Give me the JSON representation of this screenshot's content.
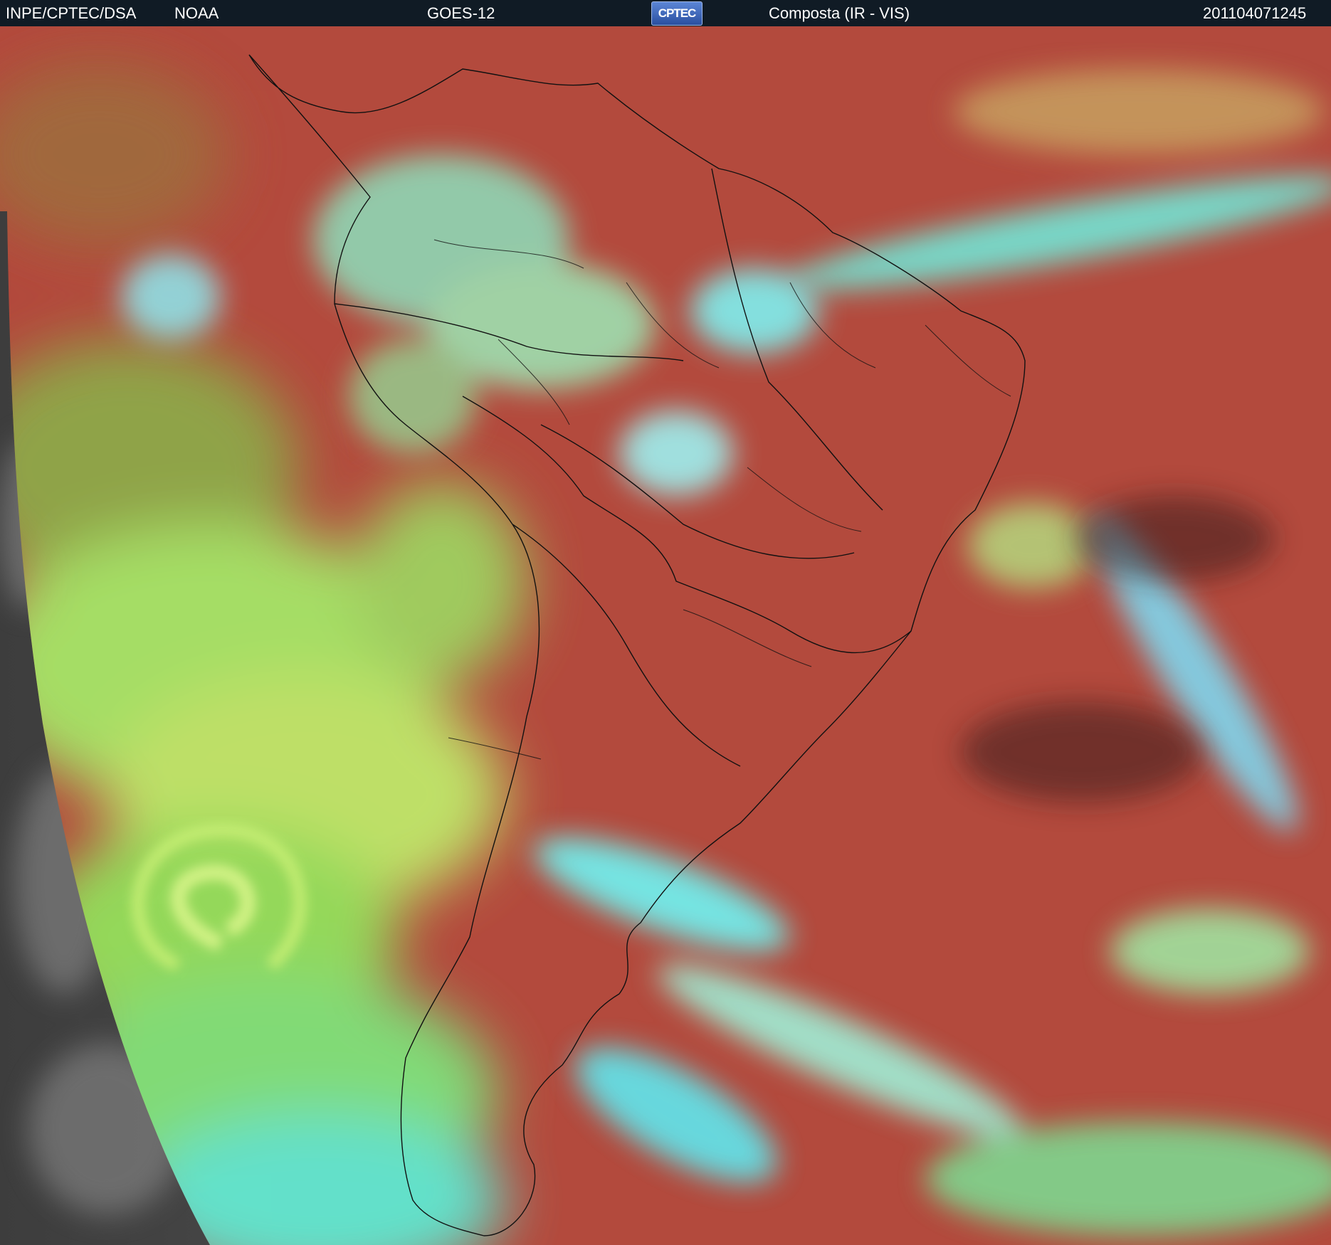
{
  "header": {
    "source": "INPE/CPTEC/DSA",
    "agency": "NOAA",
    "satellite": "GOES-12",
    "logo_text": "CPTEC",
    "product": "Composta (IR - VIS)",
    "timestamp": "201104071245"
  },
  "image": {
    "description_icon": "satellite-composite-image",
    "colors": {
      "ocean_clear": "#b54a3e",
      "land": "#a8483c",
      "cloud_high": "#5ef2f0",
      "cloud_low": "#9fe860",
      "offdisk": "#5a5a5a"
    }
  }
}
